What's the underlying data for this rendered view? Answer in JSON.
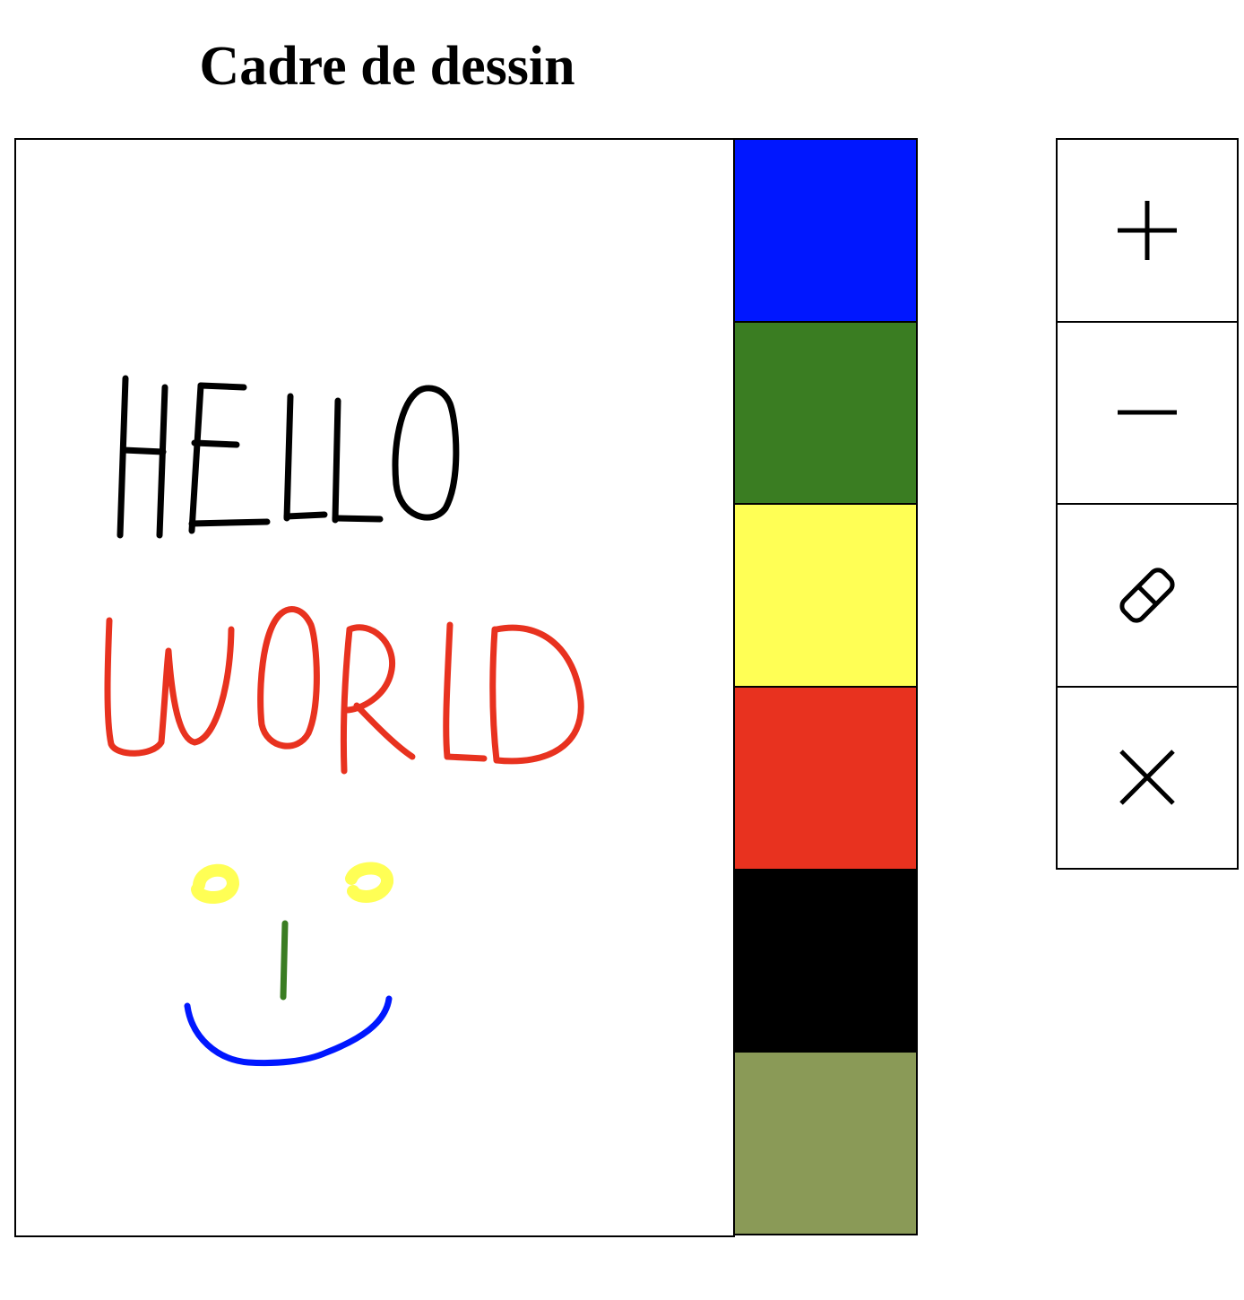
{
  "title": "Cadre de dessin",
  "canvas": {
    "strokes": [
      {
        "name": "hello",
        "color": "#000000"
      },
      {
        "name": "world",
        "color": "#e8321f"
      },
      {
        "name": "eyes",
        "color": "#ffff55"
      },
      {
        "name": "nose",
        "color": "#3a7d22"
      },
      {
        "name": "mouth",
        "color": "#0017ff"
      }
    ]
  },
  "palette": {
    "colors": [
      {
        "name": "blue",
        "hex": "#0017ff"
      },
      {
        "name": "green",
        "hex": "#3a7d22"
      },
      {
        "name": "yellow",
        "hex": "#ffff55"
      },
      {
        "name": "red",
        "hex": "#e8321f"
      },
      {
        "name": "black",
        "hex": "#000000"
      },
      {
        "name": "olive",
        "hex": "#8a9a57"
      }
    ]
  },
  "tools": [
    {
      "name": "increase-size",
      "icon": "plus-icon"
    },
    {
      "name": "decrease-size",
      "icon": "minus-icon"
    },
    {
      "name": "eraser",
      "icon": "eraser-icon"
    },
    {
      "name": "clear",
      "icon": "close-icon"
    }
  ]
}
